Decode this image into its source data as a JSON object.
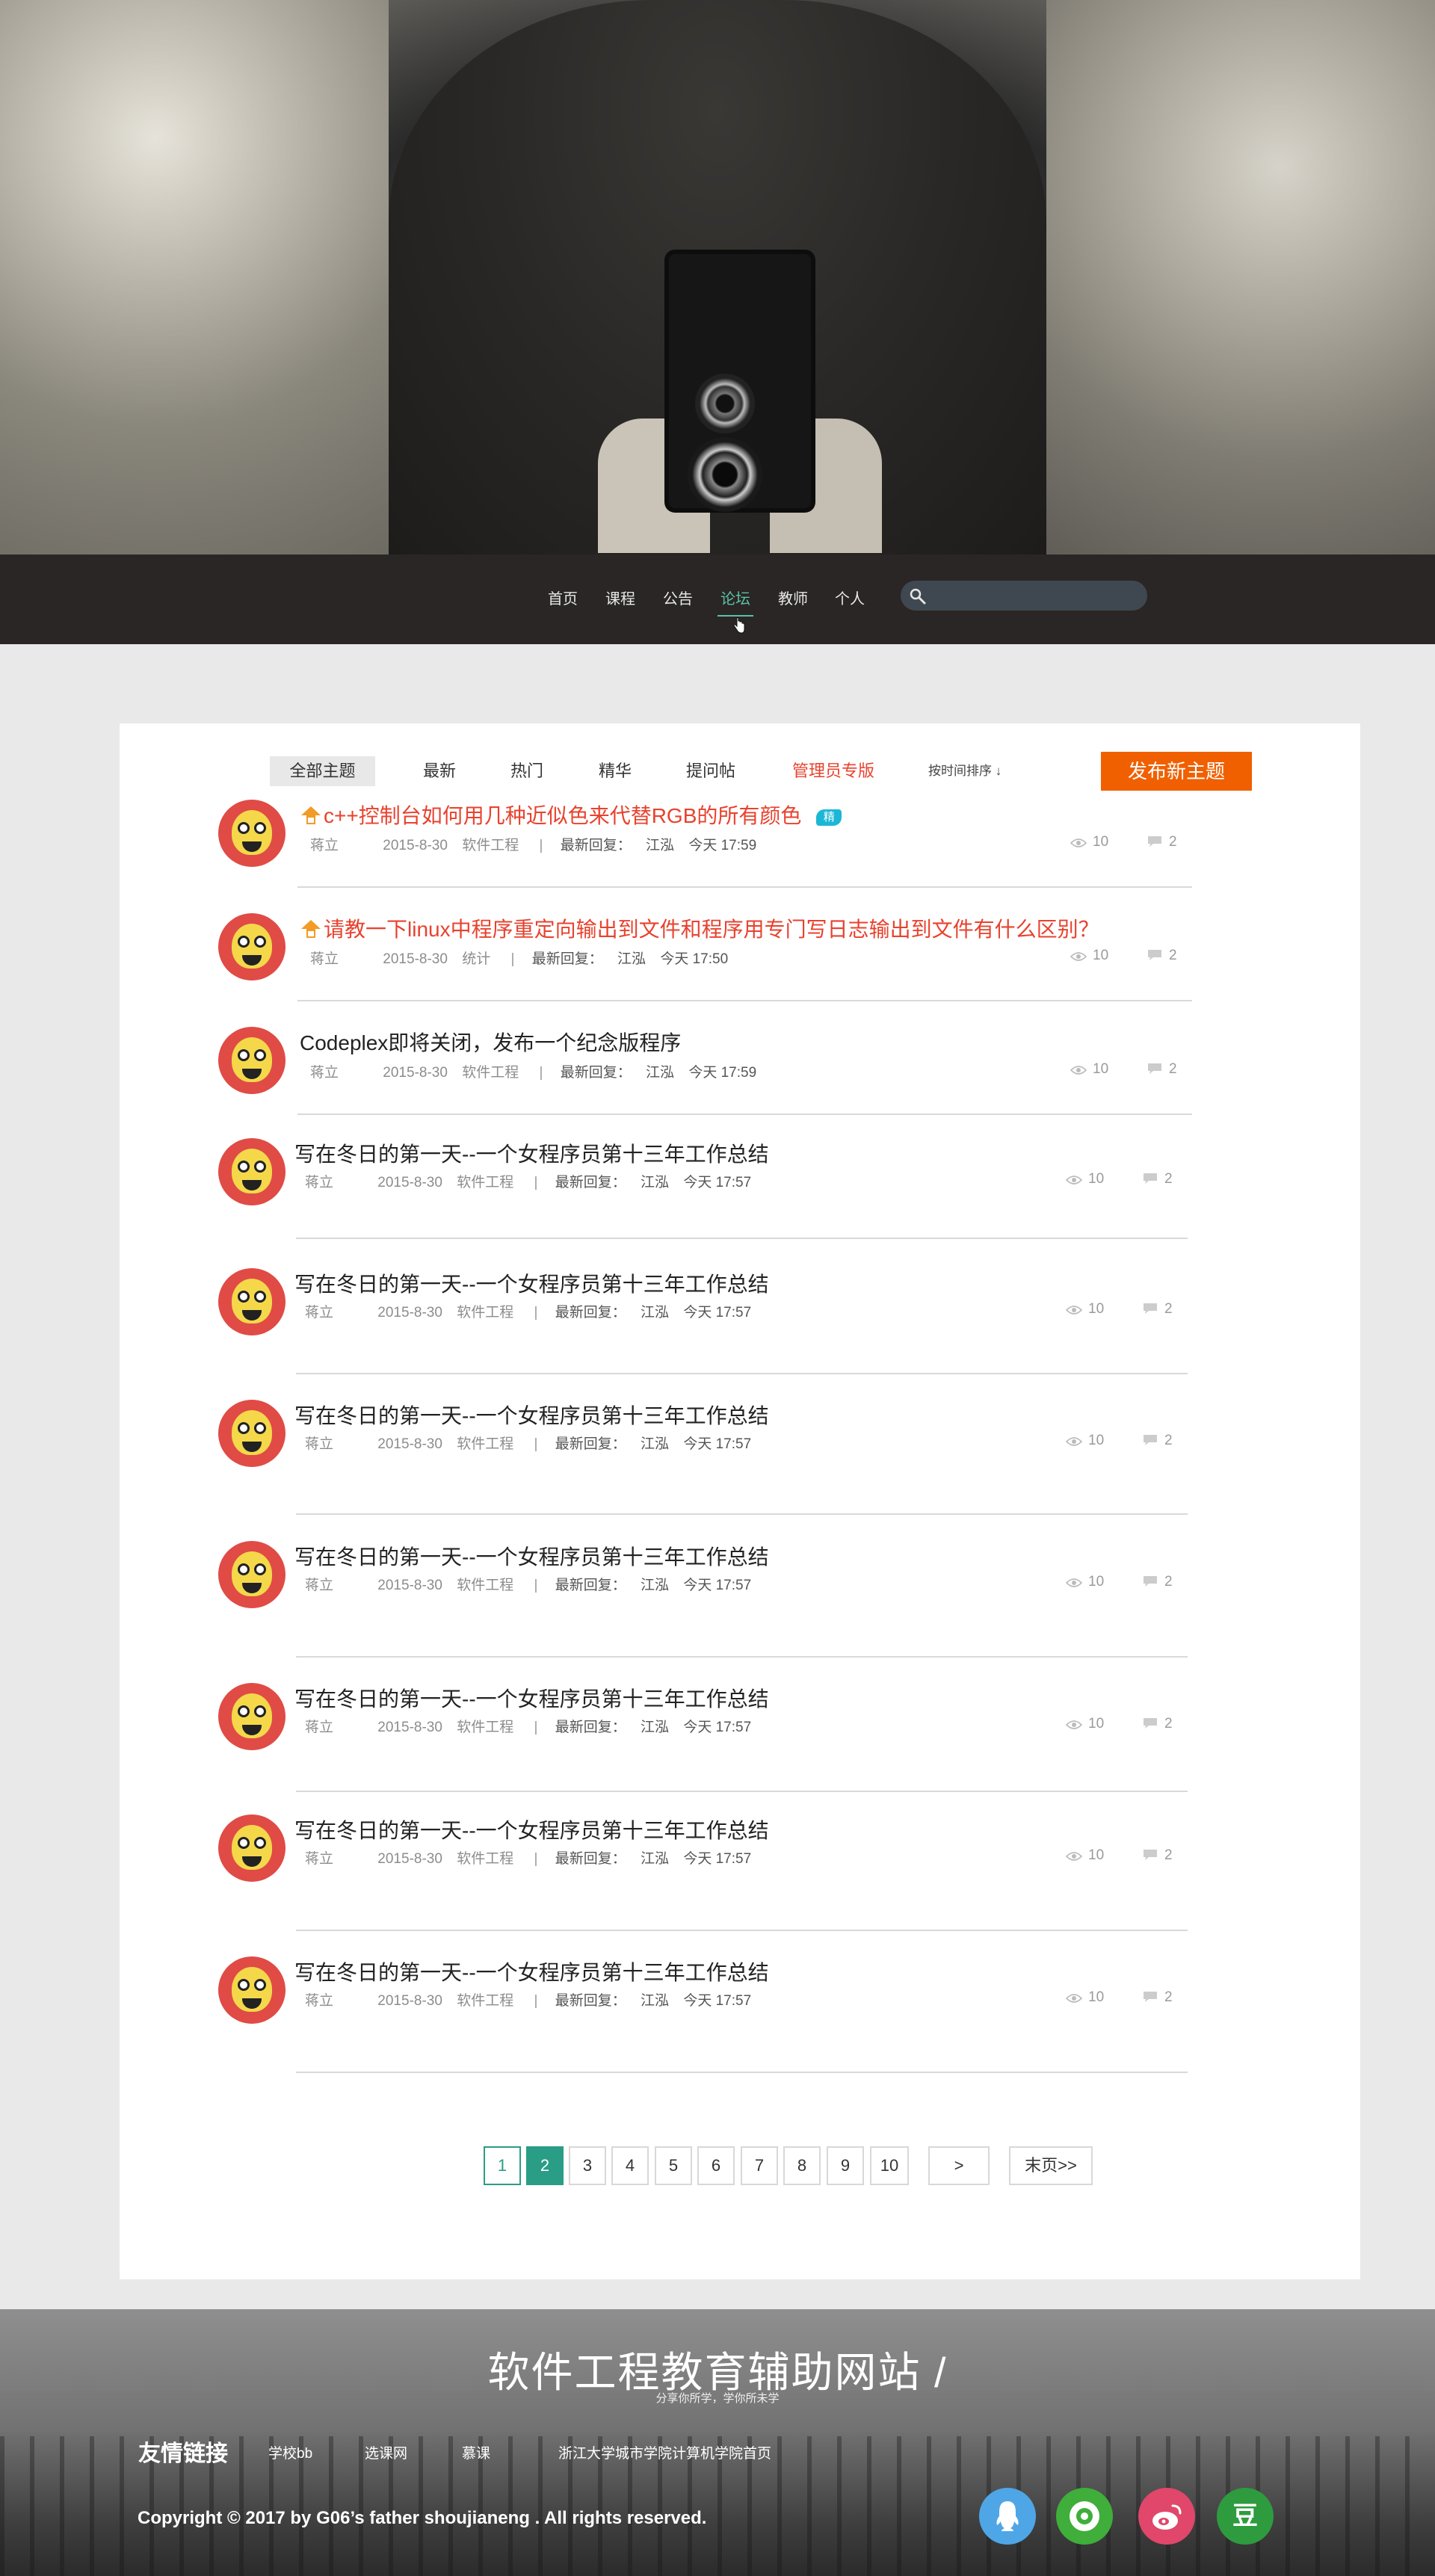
{
  "nav": {
    "items": [
      {
        "label": "首页"
      },
      {
        "label": "课程"
      },
      {
        "label": "公告"
      },
      {
        "label": "论坛"
      },
      {
        "label": "教师"
      },
      {
        "label": "个人"
      }
    ],
    "active_index": 3,
    "search": {
      "placeholder": "",
      "value": ""
    }
  },
  "forum": {
    "tabs": [
      {
        "label": "全部主题"
      },
      {
        "label": "最新"
      },
      {
        "label": "热门"
      },
      {
        "label": "精华"
      },
      {
        "label": "提问帖"
      },
      {
        "label": "管理员专版"
      }
    ],
    "sort_label": "按时间排序 ↓",
    "new_topic_label": "发布新主题",
    "posts": [
      {
        "title": "c++控制台如何用几种近似色来代替RGB的所有颜色",
        "pinned": true,
        "badge": "精",
        "author": "蒋立",
        "date": "2015-8-30",
        "category": "软件工程",
        "last_reply_label": "最新回复：",
        "last_reply_user": "江泓",
        "last_reply_time": "今天 17:59",
        "views": "10",
        "replies": "2"
      },
      {
        "title": "请教一下linux中程序重定向输出到文件和程序用专门写日志输出到文件有什么区别？",
        "pinned": true,
        "author": "蒋立",
        "date": "2015-8-30",
        "category": "统计",
        "last_reply_label": "最新回复：",
        "last_reply_user": "江泓",
        "last_reply_time": "今天 17:50",
        "views": "10",
        "replies": "2"
      },
      {
        "title": "Codeplex即将关闭，发布一个纪念版程序",
        "author": "蒋立",
        "date": "2015-8-30",
        "category": "软件工程",
        "last_reply_label": "最新回复：",
        "last_reply_user": "江泓",
        "last_reply_time": "今天 17:59",
        "views": "10",
        "replies": "2"
      },
      {
        "title": "写在冬日的第一天--一个女程序员第十三年工作总结",
        "author": "蒋立",
        "date": "2015-8-30",
        "category": "软件工程",
        "last_reply_label": "最新回复：",
        "last_reply_user": "江泓",
        "last_reply_time": "今天 17:57",
        "views": "10",
        "replies": "2"
      },
      {
        "title": "写在冬日的第一天--一个女程序员第十三年工作总结",
        "author": "蒋立",
        "date": "2015-8-30",
        "category": "软件工程",
        "last_reply_label": "最新回复：",
        "last_reply_user": "江泓",
        "last_reply_time": "今天 17:57",
        "views": "10",
        "replies": "2"
      },
      {
        "title": "写在冬日的第一天--一个女程序员第十三年工作总结",
        "author": "蒋立",
        "date": "2015-8-30",
        "category": "软件工程",
        "last_reply_label": "最新回复：",
        "last_reply_user": "江泓",
        "last_reply_time": "今天 17:57",
        "views": "10",
        "replies": "2"
      },
      {
        "title": "写在冬日的第一天--一个女程序员第十三年工作总结",
        "author": "蒋立",
        "date": "2015-8-30",
        "category": "软件工程",
        "last_reply_label": "最新回复：",
        "last_reply_user": "江泓",
        "last_reply_time": "今天 17:57",
        "views": "10",
        "replies": "2"
      },
      {
        "title": "写在冬日的第一天--一个女程序员第十三年工作总结",
        "author": "蒋立",
        "date": "2015-8-30",
        "category": "软件工程",
        "last_reply_label": "最新回复：",
        "last_reply_user": "江泓",
        "last_reply_time": "今天 17:57",
        "views": "10",
        "replies": "2"
      },
      {
        "title": "写在冬日的第一天--一个女程序员第十三年工作总结",
        "author": "蒋立",
        "date": "2015-8-30",
        "category": "软件工程",
        "last_reply_label": "最新回复：",
        "last_reply_user": "江泓",
        "last_reply_time": "今天 17:57",
        "views": "10",
        "replies": "2"
      },
      {
        "title": "写在冬日的第一天--一个女程序员第十三年工作总结",
        "author": "蒋立",
        "date": "2015-8-30",
        "category": "软件工程",
        "last_reply_label": "最新回复：",
        "last_reply_user": "江泓",
        "last_reply_time": "今天 17:57",
        "views": "10",
        "replies": "2"
      }
    ],
    "pagination": {
      "pages": [
        "1",
        "2",
        "3",
        "4",
        "5",
        "6",
        "7",
        "8",
        "9",
        "10"
      ],
      "current_page": 2,
      "next_label": ">",
      "last_label": "末页>>"
    }
  },
  "footer": {
    "site_title": "软件工程教育辅助网站 /",
    "site_subtitle": "分享你所学，学你所未学",
    "links_label": "友情链接",
    "links": [
      "学校bb",
      "选课网",
      "慕课",
      "浙江大学城市学院计算机学院首页"
    ],
    "copyright": "Copyright © 2017 by G06’s father shoujianeng . All rights reserved.",
    "social": [
      {
        "icon": "qq-icon",
        "color": "#4ea6e6"
      },
      {
        "icon": "wechat-moments-icon",
        "color": "#3fae3a"
      },
      {
        "icon": "weibo-icon",
        "color": "#e0476a"
      },
      {
        "icon": "douban-icon",
        "color": "#2e9b3f",
        "text": "豆"
      }
    ]
  },
  "colors": {
    "accent_green": "#2a9d86",
    "nav_active": "#5bc0a6",
    "hot_red": "#e8422e",
    "button_orange": "#f06000",
    "nav_bg": "#2a2625"
  }
}
